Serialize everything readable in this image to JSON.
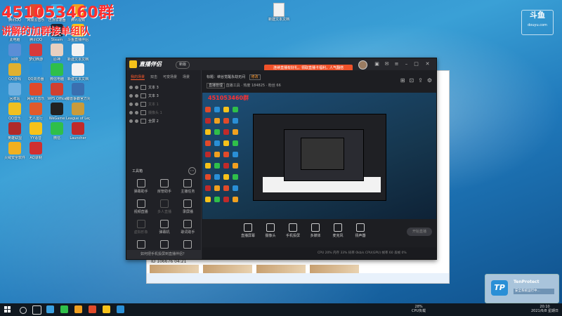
{
  "overlay": {
    "line1": "451053460群",
    "line2": "讲解的加群接单组队"
  },
  "douyu": {
    "logo": "斗鱼",
    "sub": "douyu.com"
  },
  "desktop_file": {
    "label": "新建文本文档"
  },
  "desktop_icons": [
    {
      "label": "腾讯QQ"
    },
    {
      "label": "网易云音乐"
    },
    {
      "label": "迅游加速器"
    },
    {
      "label": "腾讯视频"
    },
    {
      "label": "此电脑"
    },
    {
      "label": "腾讯QQ"
    },
    {
      "label": "Steam"
    },
    {
      "label": "斗鱼直播伴侣"
    },
    {
      "label": "网络"
    },
    {
      "label": "梦幻西游"
    },
    {
      "label": "原神"
    },
    {
      "label": "新建文本文档"
    },
    {
      "label": "QQ游戏"
    },
    {
      "label": "QQ浏览器"
    },
    {
      "label": "微信电脑"
    },
    {
      "label": "新建文本文档"
    },
    {
      "label": "回收站"
    },
    {
      "label": "网易云音乐"
    },
    {
      "label": "WPS Office"
    },
    {
      "label": "魔兽争霸官方对战平台"
    },
    {
      "label": "QQ音乐"
    },
    {
      "label": "无人运行"
    },
    {
      "label": "WeGame"
    },
    {
      "label": "League of Legends"
    },
    {
      "label": "英雄联盟"
    },
    {
      "label": "YY语音"
    },
    {
      "label": "微信"
    },
    {
      "label": "Launcher"
    },
    {
      "label": "火绒安全软件"
    },
    {
      "label": "AQ录制"
    }
  ],
  "app": {
    "title": "直播伴侣",
    "version": "新版",
    "promo": "连续直播有好礼，领取直播卡福利，人气翻倍",
    "source_tabs": [
      "我的场景",
      "双击",
      "可变场景",
      "场景"
    ],
    "sources": [
      {
        "label": "文本 3",
        "dim": false
      },
      {
        "label": "文本 3",
        "dim": false
      },
      {
        "label": "文本 1",
        "dim": true
      },
      {
        "label": "摄像头 1",
        "dim": true
      },
      {
        "label": "全屏 2",
        "dim": false
      }
    ],
    "toolbox_label": "工具箱",
    "tools": [
      {
        "label": "弹幕助手",
        "dim": false
      },
      {
        "label": "房管助手",
        "dim": false
      },
      {
        "label": "主播任务",
        "dim": false
      },
      {
        "label": "视频直播",
        "dim": false
      },
      {
        "label": "多人直播",
        "dim": true
      },
      {
        "label": "录屏播",
        "dim": false
      },
      {
        "label": "虚拟形象",
        "dim": true
      },
      {
        "label": "弹幕机",
        "dim": false
      },
      {
        "label": "歌词助手",
        "dim": false
      },
      {
        "label": "",
        "dim": false
      },
      {
        "label": "",
        "dim": false
      },
      {
        "label": "",
        "dim": false
      }
    ],
    "bottom_notice": "如何把手机投屏到直播伴侣？",
    "room_title": "标题：峡谷觉醒永劫无间",
    "room_tag": "修改",
    "room_stats_btn": "直播管理",
    "room_stats_text": "直播工具 · 热度 184825 · 粉丝 66",
    "preview_text": "451053460群",
    "controls": [
      {
        "label": "直播屏幕"
      },
      {
        "label": "摄像头"
      },
      {
        "label": "手机投屏"
      },
      {
        "label": "多媒体"
      },
      {
        "label": "麦克风"
      },
      {
        "label": "扬声器"
      }
    ],
    "start_live": "开始直播",
    "status_text": "CPU 20%   内存 33%   码率 0kb/s   CPU(GPU)   帧率 60   丢帧 0%"
  },
  "back_window": {
    "chat_text": "ID 106676   04:21"
  },
  "tenprotect": {
    "title": "TenProtect",
    "message": "安全系统运行中..."
  },
  "taskbar": {
    "cpu_pct": "28%",
    "cpu_label": "CPU负载",
    "time": "20:10",
    "date": "2021/6/8 星期日"
  },
  "colors": {
    "accent": "#ff5a2b",
    "overlay_red": "#ff2f2f",
    "tp_blue": "#2a8fd6"
  }
}
